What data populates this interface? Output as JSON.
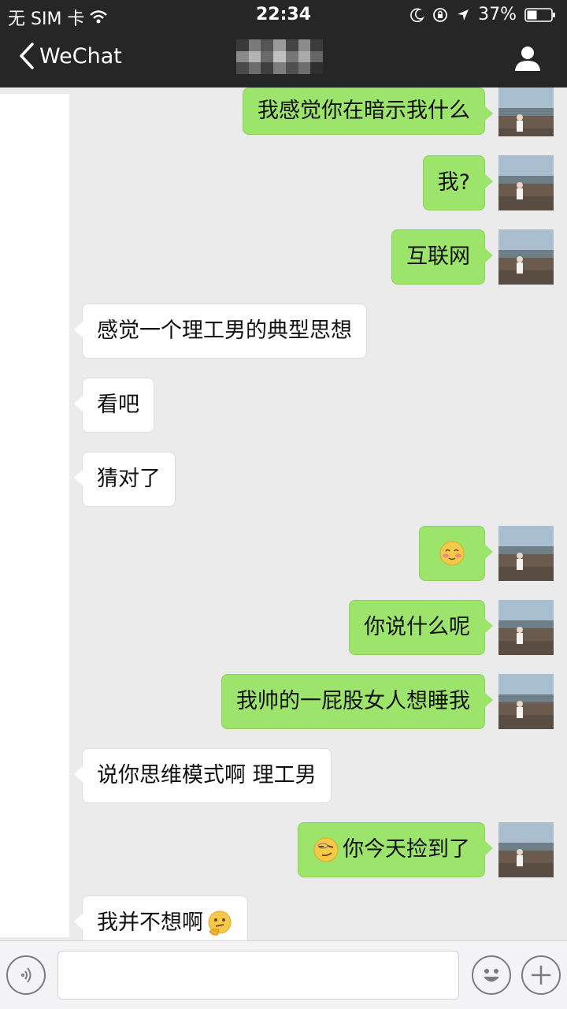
{
  "status": {
    "carrier": "无 SIM 卡",
    "time": "22:34",
    "battery": "37%"
  },
  "nav": {
    "back_label": "WeChat"
  },
  "messages": [
    {
      "side": "out",
      "text": "我感觉你在暗示我什么"
    },
    {
      "side": "out",
      "text": "我?"
    },
    {
      "side": "out",
      "text": "互联网"
    },
    {
      "side": "in",
      "text": "感觉一个理工男的典型思想"
    },
    {
      "side": "in",
      "text": "看吧"
    },
    {
      "side": "in",
      "text": "猜对了"
    },
    {
      "side": "out",
      "text": "",
      "emoji": "blushing-face-emoji"
    },
    {
      "side": "out",
      "text": "你说什么呢"
    },
    {
      "side": "out",
      "text": "我帅的一屁股女人想睡我"
    },
    {
      "side": "in",
      "text": "说你思维模式啊 理工男"
    },
    {
      "side": "out",
      "text": "你今天捡到了",
      "emoji": "smirking-face-emoji"
    },
    {
      "side": "in",
      "text": "我并不想啊",
      "emoji": "thinking-face-emoji"
    }
  ],
  "colors": {
    "bar": "#262626",
    "background": "#ebebeb",
    "outgoing_bubble": "#9ce46c",
    "incoming_bubble": "#ffffff"
  }
}
